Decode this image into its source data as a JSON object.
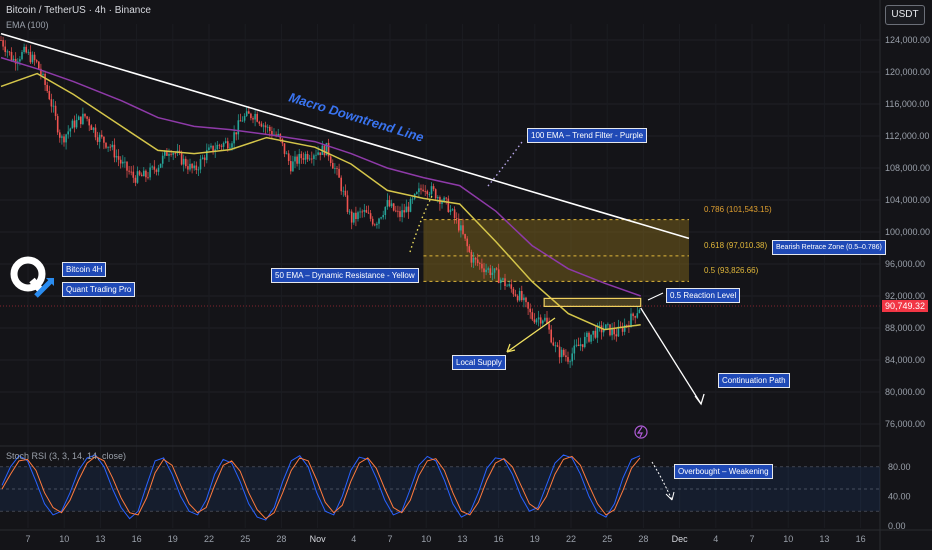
{
  "header": {
    "title": "Bitcoin / TetherUS · 4h · Binance",
    "indicator_label": "EMA (100)",
    "currency_button": "USDT"
  },
  "branding": {
    "tag1": "Bitcoin 4H",
    "tag2": "Quant Trading Pro"
  },
  "annotations": {
    "downtrend": "Macro Downtrend Line",
    "ema100": "100 EMA – Trend Filter - Purple",
    "ema50": "50 EMA – Dynamic Resistance - Yellow",
    "reaction": "0.5 Reaction Level",
    "supply": "Local Supply",
    "continuation": "Continuation Path",
    "retrace_zone": "Bearish Retrace Zone (0.5–0.786)",
    "overbought": "Overbought – Weakening"
  },
  "fib_levels": [
    {
      "label": "0.786 (101,543.15)",
      "price": 101543.15
    },
    {
      "label": "0.618 (97,010.38)",
      "price": 97010.38
    },
    {
      "label": "0.5 (93,826.66)",
      "price": 93826.66
    }
  ],
  "current_price": {
    "label": "90,749.32",
    "value": 90749.32
  },
  "stoch": {
    "label": "Stoch RSI (3, 3, 14, 14, close)",
    "ticks": [
      "80.00",
      "40.00",
      "0.00"
    ],
    "tick_values": [
      80,
      40,
      0
    ]
  },
  "colors": {
    "up": "#26a69a",
    "down": "#ef5350",
    "ema50": "#d4c54a",
    "ema100": "#8e3aa8",
    "trendline": "#ffffff",
    "fib_zone": "#8a6d1a",
    "fib_line": "#e0b73a",
    "stoch_k": "#2962ff",
    "stoch_d": "#ff7a3d",
    "accent_blue": "#1f49b6"
  },
  "chart_data": {
    "type": "candlestick",
    "symbol": "Bitcoin / TetherUS",
    "interval": "4h",
    "exchange": "Binance",
    "ylim": [
      74000,
      126000
    ],
    "y_ticks": [
      "124,000.00",
      "120,000.00",
      "116,000.00",
      "112,000.00",
      "108,000.00",
      "104,000.00",
      "100,000.00",
      "96,000.00",
      "92,000.00",
      "88,000.00",
      "84,000.00",
      "80,000.00",
      "76,000.00"
    ],
    "y_tick_values": [
      124000,
      120000,
      116000,
      112000,
      108000,
      104000,
      100000,
      96000,
      92000,
      88000,
      84000,
      80000,
      76000
    ],
    "x_ticks": [
      "7",
      "10",
      "13",
      "16",
      "19",
      "22",
      "25",
      "28",
      "Nov",
      "4",
      "7",
      "10",
      "13",
      "16",
      "19",
      "22",
      "25",
      "28",
      "Dec",
      "4",
      "7",
      "10",
      "13",
      "16"
    ],
    "close_path": [
      {
        "date": "Oct 6",
        "price": 124000
      },
      {
        "date": "Oct 7",
        "price": 121500
      },
      {
        "date": "Oct 8",
        "price": 122500
      },
      {
        "date": "Oct 9",
        "price": 121000
      },
      {
        "date": "Oct 10",
        "price": 117000
      },
      {
        "date": "Oct 11",
        "price": 111500
      },
      {
        "date": "Oct 12",
        "price": 113500
      },
      {
        "date": "Oct 13",
        "price": 114500
      },
      {
        "date": "Oct 14",
        "price": 112000
      },
      {
        "date": "Oct 15",
        "price": 110800
      },
      {
        "date": "Oct 16",
        "price": 108500
      },
      {
        "date": "Oct 17",
        "price": 106800
      },
      {
        "date": "Oct 18",
        "price": 107000
      },
      {
        "date": "Oct 19",
        "price": 108300
      },
      {
        "date": "Oct 20",
        "price": 110500
      },
      {
        "date": "Oct 21",
        "price": 109000
      },
      {
        "date": "Oct 22",
        "price": 107600
      },
      {
        "date": "Oct 23",
        "price": 109800
      },
      {
        "date": "Oct 24",
        "price": 110800
      },
      {
        "date": "Oct 25",
        "price": 111300
      },
      {
        "date": "Oct 26",
        "price": 114200
      },
      {
        "date": "Oct 27",
        "price": 114800
      },
      {
        "date": "Oct 28",
        "price": 113000
      },
      {
        "date": "Oct 29",
        "price": 111800
      },
      {
        "date": "Oct 30",
        "price": 108300
      },
      {
        "date": "Oct 31",
        "price": 109500
      },
      {
        "date": "Nov 1",
        "price": 110000
      },
      {
        "date": "Nov 2",
        "price": 110400
      },
      {
        "date": "Nov 3",
        "price": 106600
      },
      {
        "date": "Nov 4",
        "price": 101500
      },
      {
        "date": "Nov 5",
        "price": 102500
      },
      {
        "date": "Nov 6",
        "price": 101200
      },
      {
        "date": "Nov 7",
        "price": 103500
      },
      {
        "date": "Nov 8",
        "price": 102000
      },
      {
        "date": "Nov 9",
        "price": 103500
      },
      {
        "date": "Nov 10",
        "price": 105800
      },
      {
        "date": "Nov 11",
        "price": 104800
      },
      {
        "date": "Nov 12",
        "price": 103300
      },
      {
        "date": "Nov 13",
        "price": 100600
      },
      {
        "date": "Nov 14",
        "price": 96600
      },
      {
        "date": "Nov 15",
        "price": 95600
      },
      {
        "date": "Nov 16",
        "price": 94700
      },
      {
        "date": "Nov 17",
        "price": 93200
      },
      {
        "date": "Nov 18",
        "price": 91900
      },
      {
        "date": "Nov 19",
        "price": 89300
      },
      {
        "date": "Nov 20",
        "price": 89300
      },
      {
        "date": "Nov 21",
        "price": 85200
      },
      {
        "date": "Nov 22",
        "price": 84300
      },
      {
        "date": "Nov 23",
        "price": 86000
      },
      {
        "date": "Nov 24",
        "price": 87300
      },
      {
        "date": "Nov 25",
        "price": 88000
      },
      {
        "date": "Nov 26",
        "price": 87300
      },
      {
        "date": "Nov 27",
        "price": 88800
      },
      {
        "date": "Nov 28",
        "price": 90800
      }
    ],
    "ema50_path": [
      {
        "date": "Oct 6",
        "price": 118200
      },
      {
        "date": "Oct 9",
        "price": 119800
      },
      {
        "date": "Oct 12",
        "price": 117200
      },
      {
        "date": "Oct 16",
        "price": 113200
      },
      {
        "date": "Oct 19",
        "price": 110200
      },
      {
        "date": "Oct 22",
        "price": 109800
      },
      {
        "date": "Oct 25",
        "price": 110300
      },
      {
        "date": "Oct 28",
        "price": 111800
      },
      {
        "date": "Nov 1",
        "price": 110600
      },
      {
        "date": "Nov 4",
        "price": 108500
      },
      {
        "date": "Nov 7",
        "price": 105200
      },
      {
        "date": "Nov 10",
        "price": 104200
      },
      {
        "date": "Nov 13",
        "price": 103500
      },
      {
        "date": "Nov 16",
        "price": 98800
      },
      {
        "date": "Nov 19",
        "price": 93800
      },
      {
        "date": "Nov 22",
        "price": 89800
      },
      {
        "date": "Nov 25",
        "price": 87800
      },
      {
        "date": "Nov 28",
        "price": 88400
      }
    ],
    "ema100_path": [
      {
        "date": "Oct 6",
        "price": 121800
      },
      {
        "date": "Oct 9",
        "price": 120400
      },
      {
        "date": "Oct 12",
        "price": 118800
      },
      {
        "date": "Oct 16",
        "price": 116400
      },
      {
        "date": "Oct 19",
        "price": 114300
      },
      {
        "date": "Oct 22",
        "price": 113200
      },
      {
        "date": "Oct 25",
        "price": 112800
      },
      {
        "date": "Oct 28",
        "price": 112200
      },
      {
        "date": "Nov 1",
        "price": 111300
      },
      {
        "date": "Nov 4",
        "price": 109800
      },
      {
        "date": "Nov 7",
        "price": 108000
      },
      {
        "date": "Nov 10",
        "price": 106800
      },
      {
        "date": "Nov 13",
        "price": 105800
      },
      {
        "date": "Nov 16",
        "price": 102600
      },
      {
        "date": "Nov 19",
        "price": 98300
      },
      {
        "date": "Nov 22",
        "price": 95400
      },
      {
        "date": "Nov 25",
        "price": 93600
      },
      {
        "date": "Nov 28",
        "price": 92000
      }
    ],
    "downtrend_line": [
      {
        "date": "Oct 6",
        "price": 124800
      },
      {
        "date": "Dec 2",
        "price": 99200
      }
    ],
    "retrace_zone": {
      "from_date": "Nov 10",
      "to_date": "Dec 2",
      "low": 93826.66,
      "high": 101543.15
    },
    "reaction_box": {
      "from_date": "Nov 20",
      "to_date": "Nov 28",
      "low": 90700,
      "high": 91700
    },
    "continuation_path": [
      {
        "date": "Nov 28",
        "price": 90500
      },
      {
        "date": "Dec 3",
        "price": 78500
      }
    ],
    "stoch_rsi": {
      "ylim": [
        0,
        100
      ],
      "overbought": 80,
      "oversold": 20,
      "k": [
        55,
        80,
        95,
        88,
        60,
        30,
        15,
        20,
        45,
        75,
        92,
        96,
        80,
        50,
        25,
        10,
        20,
        55,
        88,
        92,
        70,
        40,
        20,
        15,
        35,
        70,
        90,
        85,
        60,
        30,
        12,
        8,
        25,
        60,
        88,
        95,
        80,
        45,
        20,
        15,
        40,
        75,
        93,
        90,
        65,
        35,
        15,
        20,
        50,
        82,
        94,
        88,
        62,
        30,
        12,
        18,
        45,
        78,
        92,
        90,
        70,
        40,
        20,
        25,
        55,
        85,
        96,
        92,
        70,
        40,
        18,
        12,
        30,
        65,
        90,
        95
      ],
      "d": [
        50,
        70,
        88,
        90,
        75,
        45,
        25,
        18,
        35,
        62,
        85,
        94,
        88,
        65,
        38,
        18,
        15,
        38,
        72,
        90,
        82,
        55,
        30,
        18,
        25,
        55,
        82,
        88,
        74,
        45,
        22,
        10,
        18,
        45,
        75,
        92,
        88,
        62,
        32,
        18,
        28,
        60,
        85,
        92,
        78,
        50,
        25,
        18,
        35,
        68,
        88,
        91,
        75,
        45,
        20,
        15,
        32,
        62,
        85,
        91,
        80,
        55,
        30,
        22,
        40,
        70,
        90,
        94,
        82,
        55,
        30,
        15,
        22,
        48,
        78,
        92
      ]
    }
  }
}
